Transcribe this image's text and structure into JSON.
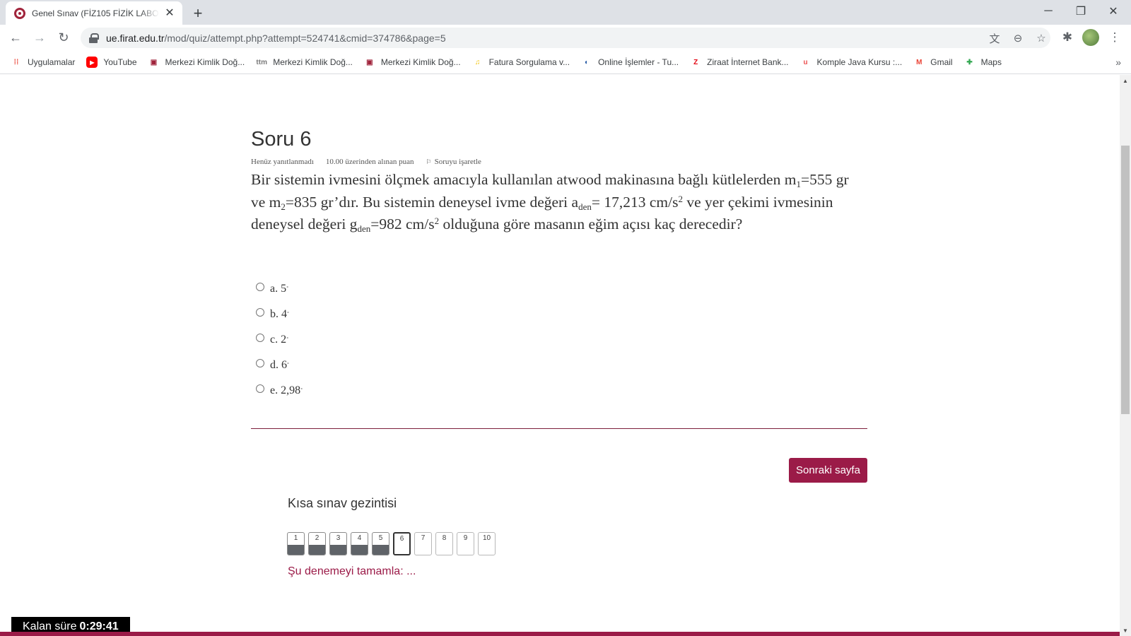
{
  "browser": {
    "tab_title": "Genel Sınav (FİZ105 FİZİK LABORATUVARI I)",
    "url_host": "ue.firat.edu.tr",
    "url_path": "/mod/quiz/attempt.php?attempt=524741&cmid=374786&page=5",
    "bookmarks": [
      {
        "label": "Uygulamalar",
        "icon": "apps-grid-icon",
        "color": "#e94235"
      },
      {
        "label": "YouTube",
        "icon": "youtube-icon",
        "color": "#ff0000"
      },
      {
        "label": "Merkezi Kimlik Doğ...",
        "icon": "mkd-icon",
        "color": "#a0233b"
      },
      {
        "label": "Merkezi Kimlik Doğ...",
        "icon": "ttm-icon",
        "color": "#7a7a7a"
      },
      {
        "label": "Merkezi Kimlik Doğ...",
        "icon": "mkd-icon",
        "color": "#a0233b"
      },
      {
        "label": "Fatura Sorgulama v...",
        "icon": "fatura-icon",
        "color": "#f2c200"
      },
      {
        "label": "Online İşlemler - Tu...",
        "icon": "turkcell-icon",
        "color": "#2b5ea8"
      },
      {
        "label": "Ziraat İnternet Bank...",
        "icon": "ziraat-icon",
        "color": "#e30613"
      },
      {
        "label": "Komple Java Kursu :...",
        "icon": "udemy-icon",
        "color": "#ec5252"
      },
      {
        "label": "Gmail",
        "icon": "gmail-icon",
        "color": "#ea4335"
      },
      {
        "label": "Maps",
        "icon": "maps-icon",
        "color": "#34a853"
      }
    ]
  },
  "question": {
    "title": "Soru 6",
    "status": "Henüz yanıtlanmadı",
    "points": "10.00 üzerinden alınan puan",
    "flag": "Soruyu işaretle",
    "text_parts": {
      "p1": "Bir sistemin ivmesini ölçmek amacıyla kullanılan atwood makinasına bağlı kütlelerden m",
      "s1": "1",
      "p2": "=555 gr ve m",
      "s2": "2",
      "p3": "=835 gr’dır. Bu sistemin deneysel ivme değeri a",
      "s3": "den",
      "p4": "= 17,213 cm/s",
      "sup1": "2",
      "p5": " ve yer çekimi ivmesinin deneysel değeri g",
      "s4": "den",
      "p6": "=982 cm/s",
      "sup2": "2",
      "p7": " olduğuna göre masanın eğim açısı kaç derecedir?"
    },
    "answers": [
      {
        "label": "a. 5",
        "degree": "˚"
      },
      {
        "label": "b. 4",
        "degree": "˚"
      },
      {
        "label": "c. 2",
        "degree": "˚"
      },
      {
        "label": "d. 6",
        "degree": "˚"
      },
      {
        "label": "e. 2,98",
        "degree": "˚"
      }
    ]
  },
  "next_button": "Sonraki sayfa",
  "navigation": {
    "title": "Kısa sınav gezintisi",
    "pages": [
      {
        "num": "1",
        "state": "done"
      },
      {
        "num": "2",
        "state": "done"
      },
      {
        "num": "3",
        "state": "done"
      },
      {
        "num": "4",
        "state": "done"
      },
      {
        "num": "5",
        "state": "done"
      },
      {
        "num": "6",
        "state": "current"
      },
      {
        "num": "7",
        "state": "empty"
      },
      {
        "num": "8",
        "state": "empty"
      },
      {
        "num": "9",
        "state": "empty"
      },
      {
        "num": "10",
        "state": "empty"
      }
    ],
    "finish_link": "Şu denemeyi tamamla: ..."
  },
  "timer": {
    "label": "Kalan süre",
    "value": "0:29:41"
  },
  "colors": {
    "accent": "#9b1b48",
    "divider": "#7d1e3c"
  }
}
